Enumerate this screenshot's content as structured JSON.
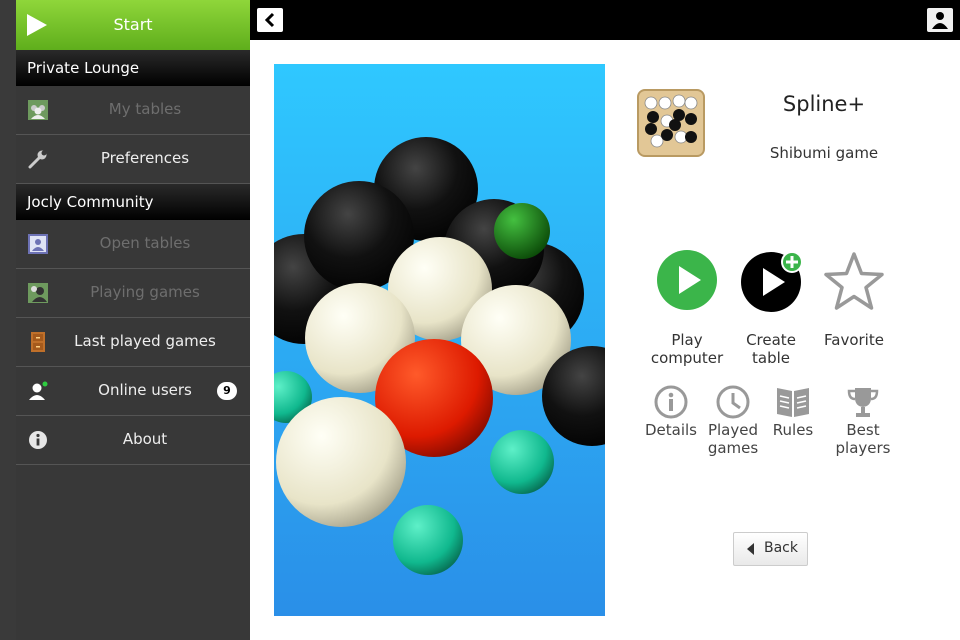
{
  "sidebar": {
    "start_label": "Start",
    "sections": [
      "Private Lounge",
      "Jocly Community"
    ],
    "items": [
      {
        "label": "My tables",
        "icon": "group-icon",
        "enabled": false
      },
      {
        "label": "Preferences",
        "icon": "wrench-icon",
        "enabled": true
      },
      {
        "label": "Open tables",
        "icon": "contact-icon",
        "enabled": false
      },
      {
        "label": "Playing games",
        "icon": "players-icon",
        "enabled": false
      },
      {
        "label": "Last played games",
        "icon": "cabinet-icon",
        "enabled": true
      },
      {
        "label": "Online users",
        "icon": "user-online-icon",
        "enabled": true,
        "badge": "9"
      },
      {
        "label": "About",
        "icon": "info-icon",
        "enabled": true
      }
    ]
  },
  "game": {
    "title": "Spline+",
    "subtitle": "Shibumi game"
  },
  "actions": {
    "play_computer": "Play\ncomputer",
    "create_table": "Create\ntable",
    "favorite": "Favorite",
    "details": "Details",
    "played_games": "Played\ngames",
    "rules": "Rules",
    "best_players": "Best\nplayers"
  },
  "back_label": "Back",
  "colors": {
    "start_green": "#6cbf25",
    "play_green": "#3bb54a",
    "sidebar_bg": "#383838"
  }
}
